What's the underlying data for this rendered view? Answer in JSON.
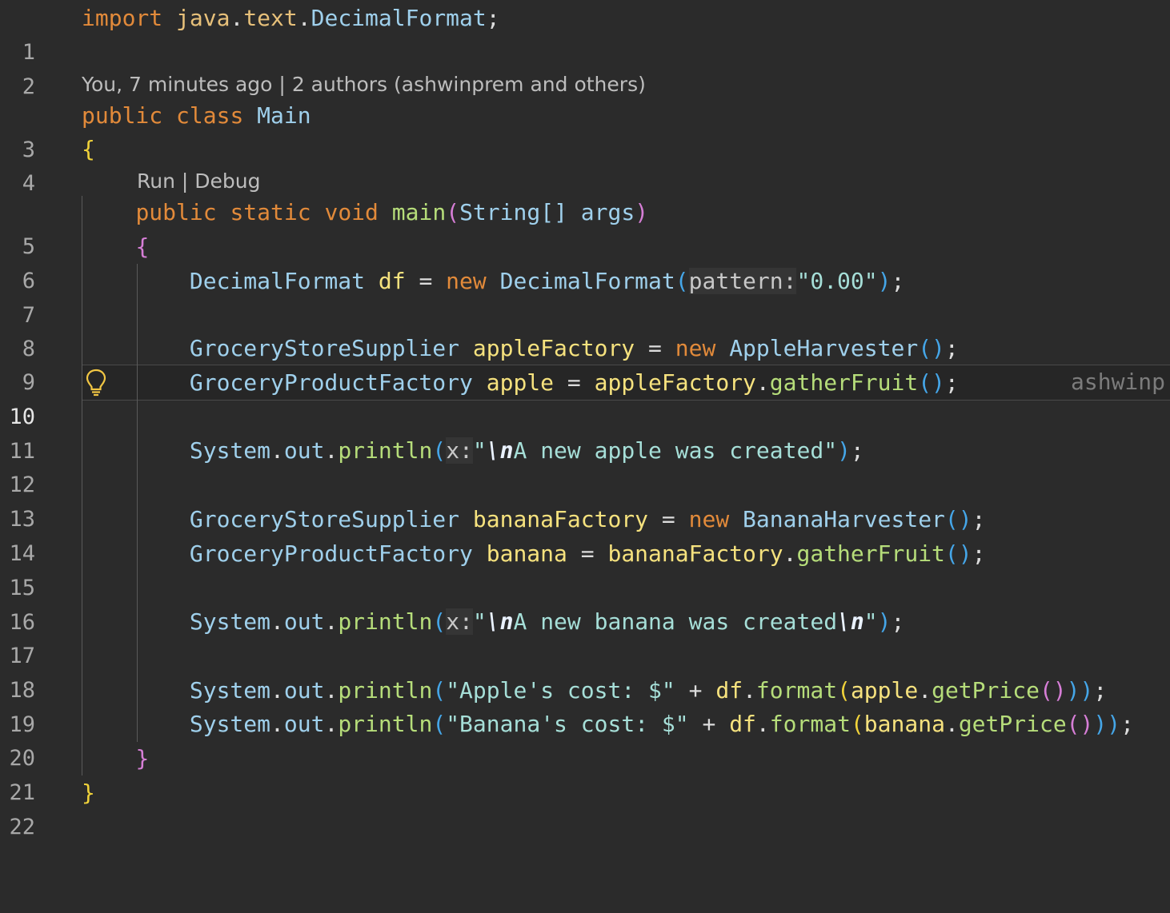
{
  "colors": {
    "background": "#2b2b2b",
    "keyword": "#e28a3a",
    "type": "#9fd0ec",
    "variable": "#f6e27e",
    "function": "#b6dd7a",
    "string": "#a6dfd8",
    "bracket_level_1": "#f1d33a",
    "bracket_level_2": "#d67ed6",
    "bracket_level_3": "#45a6e8"
  },
  "icons": {
    "lightbulb": "lightbulb-icon"
  },
  "editor": {
    "current_line": "10",
    "lens_blame": {
      "author_time": "You, 7 minutes ago",
      "separator": "|",
      "authors": "2 authors (ashwinprem and others)"
    },
    "lens_run": {
      "run": "Run",
      "separator": "|",
      "debug": "Debug"
    },
    "inline_blame": "ashwinp",
    "line_numbers": [
      "1",
      "2",
      "3",
      "4",
      "5",
      "6",
      "7",
      "8",
      "9",
      "10",
      "11",
      "12",
      "13",
      "14",
      "15",
      "16",
      "17",
      "18",
      "19",
      "20",
      "21",
      "22"
    ],
    "tokens": {
      "l1": [
        "import",
        "java",
        ".",
        "text",
        ".",
        "DecimalFormat",
        ";"
      ],
      "l3": [
        "public",
        "class",
        "Main"
      ],
      "l4": [
        "{"
      ],
      "l5": [
        "public",
        "static",
        "void",
        "main",
        "(",
        "String",
        "[]",
        "args",
        ")"
      ],
      "l6": [
        "{"
      ],
      "l7": [
        "DecimalFormat",
        "df",
        "=",
        "new",
        "DecimalFormat",
        "(",
        "pattern:",
        "\"0.00\"",
        ")",
        ";"
      ],
      "l9": [
        "GroceryStoreSupplier",
        "appleFactory",
        "=",
        "new",
        "AppleHarvester",
        "()",
        ";"
      ],
      "l10": [
        "GroceryProductFactory",
        "apple",
        "=",
        "appleFactory",
        ".",
        "gatherFruit",
        "()",
        ";"
      ],
      "l12": [
        "System",
        ".",
        "out",
        ".",
        "println",
        "(",
        "x:",
        "\"",
        "\\n",
        "A new apple was created\"",
        ")",
        ";"
      ],
      "l14": [
        "GroceryStoreSupplier",
        "bananaFactory",
        "=",
        "new",
        "BananaHarvester",
        "()",
        ";"
      ],
      "l15": [
        "GroceryProductFactory",
        "banana",
        "=",
        "bananaFactory",
        ".",
        "gatherFruit",
        "()",
        ";"
      ],
      "l17": [
        "System",
        ".",
        "out",
        ".",
        "println",
        "(",
        "x:",
        "\"",
        "\\n",
        "A new banana was created",
        "\\n",
        "\"",
        ")",
        ";"
      ],
      "l19": [
        "System",
        ".",
        "out",
        ".",
        "println",
        "(",
        "\"Apple's cost: $\"",
        "+",
        "df",
        ".",
        "format",
        "(",
        "apple",
        ".",
        "getPrice",
        "()",
        "))",
        ";"
      ],
      "l20": [
        "System",
        ".",
        "out",
        ".",
        "println",
        "(",
        "\"Banana's cost: $\"",
        "+",
        "df",
        ".",
        "format",
        "(",
        "banana",
        ".",
        "getPrice",
        "()",
        "))",
        ";"
      ],
      "l21": [
        "}"
      ],
      "l22": [
        "}"
      ]
    }
  }
}
